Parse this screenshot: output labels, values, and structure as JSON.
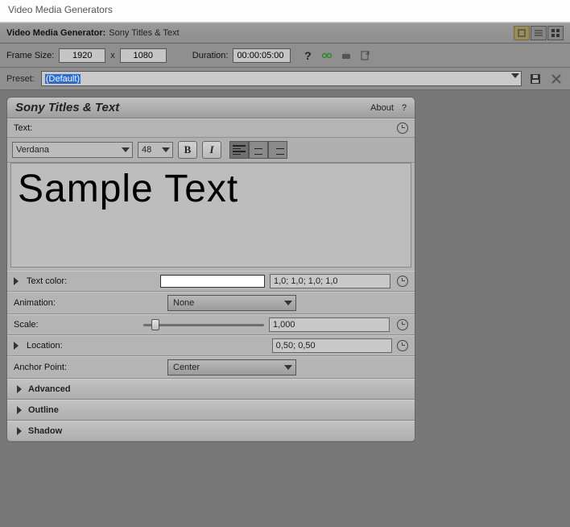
{
  "window": {
    "title": "Video Media Generators"
  },
  "header": {
    "label": "Video Media Generator:",
    "value": "Sony Titles & Text"
  },
  "params": {
    "frame_size_label": "Frame Size:",
    "width": "1920",
    "x": "x",
    "height": "1080",
    "duration_label": "Duration:",
    "duration": "00:00:05:00"
  },
  "preset": {
    "label": "Preset:",
    "value": "(Default)"
  },
  "plugin": {
    "title": "Sony Titles & Text",
    "about": "About",
    "help": "?"
  },
  "text_section": {
    "label": "Text:",
    "font": "Verdana",
    "size": "48",
    "content": "Sample Text"
  },
  "props": {
    "text_color_label": "Text color:",
    "text_color_value": "1,0; 1,0; 1,0; 1,0",
    "animation_label": "Animation:",
    "animation_value": "None",
    "scale_label": "Scale:",
    "scale_value": "1,000",
    "location_label": "Location:",
    "location_value": "0,50; 0,50",
    "anchor_label": "Anchor Point:",
    "anchor_value": "Center"
  },
  "sections": {
    "advanced": "Advanced",
    "outline": "Outline",
    "shadow": "Shadow"
  }
}
